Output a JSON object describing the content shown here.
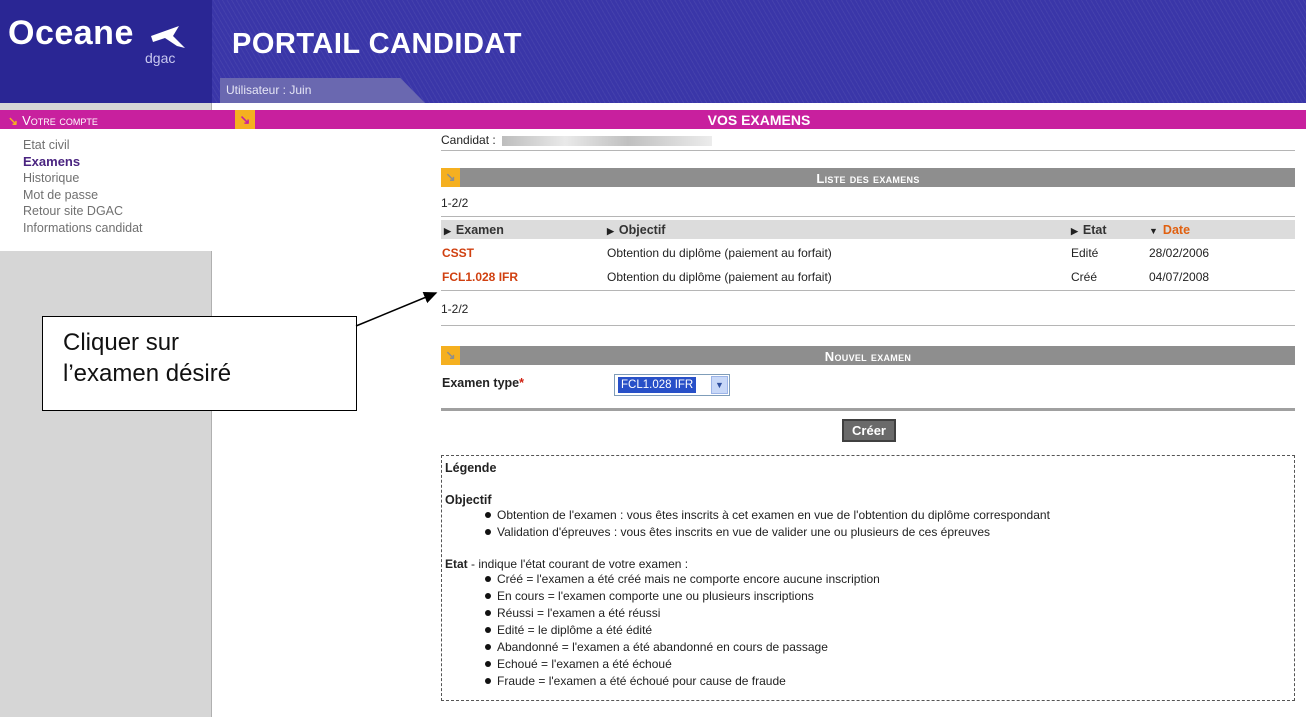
{
  "header": {
    "logo_text": "Oceane",
    "logo_sub": "dgac",
    "portal_title": "PORTAIL CANDIDAT",
    "user_label": "Utilisateur : Juin"
  },
  "sidebar": {
    "title": "Votre compte",
    "items": [
      {
        "label": "Etat civil",
        "active": false
      },
      {
        "label": "Examens",
        "active": true
      },
      {
        "label": "Historique",
        "active": false
      },
      {
        "label": "Mot de passe",
        "active": false
      },
      {
        "label": "Retour site DGAC",
        "active": false
      },
      {
        "label": "Informations candidat",
        "active": false
      }
    ]
  },
  "main": {
    "title": "VOS EXAMENS",
    "candidat_label": "Candidat :",
    "list": {
      "title": "Liste des examens",
      "count_top": "1-2/2",
      "count_bottom": "1-2/2",
      "columns": [
        "Examen",
        "Objectif",
        "Etat",
        "Date"
      ],
      "rows": [
        {
          "examen": "CSST",
          "objectif": "Obtention du diplôme (paiement au forfait)",
          "etat": "Edité",
          "date": "28/02/2006"
        },
        {
          "examen": "FCL1.028 IFR",
          "objectif": "Obtention du diplôme (paiement au forfait)",
          "etat": "Créé",
          "date": "04/07/2008"
        }
      ]
    },
    "nouvel": {
      "title": "Nouvel examen",
      "type_label": "Examen type",
      "required_mark": "*",
      "selected": "FCL1.028 IFR",
      "create_label": "Créer"
    },
    "legend": {
      "title": "Légende",
      "objectif_heading": "Objectif",
      "objectif_items": [
        "Obtention de l'examen : vous êtes inscrits à cet examen en vue de l'obtention du diplôme correspondant",
        "Validation d'épreuves : vous êtes inscrits en vue de valider une ou plusieurs de ces épreuves"
      ],
      "etat_heading": "Etat",
      "etat_intro": " - indique l'état courant de votre examen :",
      "etat_items": [
        "Créé = l'examen a été créé mais ne comporte encore aucune inscription",
        "En cours = l'examen comporte une ou plusieurs inscriptions",
        "Réussi = l'examen a été réussi",
        "Edité = le diplôme a été édité",
        "Abandonné = l'examen a été abandonné en cours de passage",
        "Echoué = l'examen a été échoué",
        "Fraude = l'examen a été échoué pour cause de fraude"
      ]
    }
  },
  "callout": {
    "line1": "Cliquer sur",
    "line2": "l’examen désiré"
  },
  "colors": {
    "brand_blue": "#2a2694",
    "magenta": "#c8209e",
    "orange_marker": "#f5b020",
    "link": "#d04010",
    "section_gray": "#8e8e8e"
  }
}
